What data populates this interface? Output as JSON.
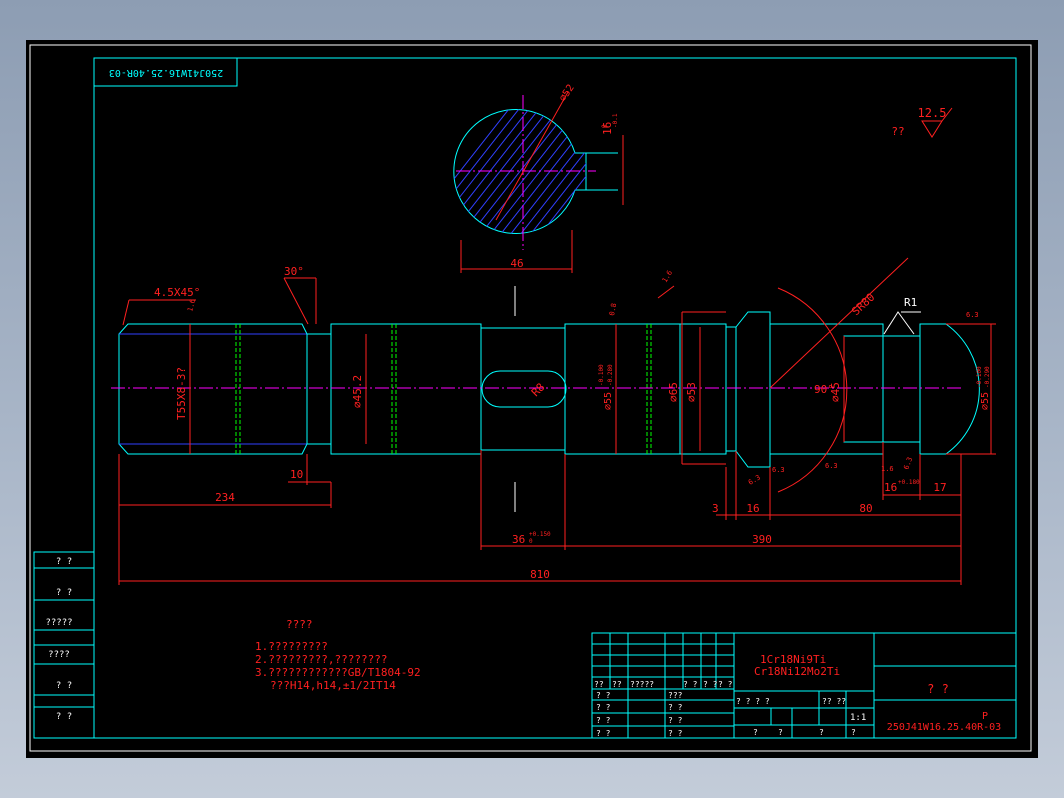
{
  "drawing": {
    "rotated_drawing_no": "250J41W16.25.40R-03",
    "roughness_symbol_value": "12.5",
    "roughness_note": "??",
    "section_dims": {
      "diameter": "⌀52",
      "keyway_depth": "16",
      "keyway_tol_top": "0",
      "keyway_tol_bot": "-0.1",
      "width": "46"
    },
    "dims": {
      "chamfer": "4.5X45°",
      "angle_30": "30°",
      "thread": "T55X8-3?",
      "dia_45_2": "⌀45.2",
      "len_10": "10",
      "len_234": "234",
      "slot_r": "R8",
      "dia_55_a": "⌀55",
      "dia_55_a_tol_top": "-0.100",
      "dia_55_a_tol_bot": "-0.280",
      "dia_65": "⌀65",
      "dia_53": "⌀53",
      "sr80": "SR80",
      "r1": "R1",
      "angle_90": "90°",
      "dia_45": "⌀45",
      "dia_55_b": "⌀55",
      "dia_55_b_tol_top": "-0.100",
      "dia_55_b_tol_bot": "-0.290",
      "len_3": "3",
      "len_16": "16",
      "len_80": "80",
      "len_16b": "16",
      "len_16b_tol": "+0.180",
      "len_17": "17",
      "len_36": "36",
      "len_36_tol_top": "+0.150",
      "len_36_tol_bot": "0",
      "len_390": "390",
      "len_810": "810",
      "rough_1_6a": "1.6",
      "rough_0_8": "0.8",
      "rough_1_6b": "1.6",
      "rough_6_3a": "6.3",
      "rough_6_3b": "6.3",
      "rough_6_3c": "6.3",
      "rough_6_3d": "6.3",
      "rough_6_3e": "6.3",
      "rough_a": "1.6",
      "rough_b": "6.3"
    },
    "notes": {
      "title": "????",
      "line1": "1.?????????",
      "line2": "2.?????????,????????",
      "line3": "3.????????????GB/T1804-92",
      "line4": "???H14,h14,±1/2IT14"
    }
  },
  "left_strip": [
    "? ?",
    "? ?",
    "?????",
    "????",
    "? ?",
    "? ?"
  ],
  "title_block": {
    "material_1": "1Cr18Ni9Ti",
    "material_2": "Cr18Ni12Mo2Ti",
    "part_name": "? ?",
    "drawing_no": "250J41W16.25.40R-03",
    "letter": "P",
    "scale": "1:1",
    "row_main": [
      "??",
      "??",
      "?????",
      "? ?",
      "? ?",
      "? ?"
    ],
    "left_rows": [
      "? ?",
      "? ?",
      "? ?",
      "? ?"
    ],
    "mid_rows": [
      "???",
      "? ?",
      "? ?",
      "? ?"
    ],
    "info_row": [
      "? ? ? ?",
      "?? ??"
    ],
    "bottom_row": [
      "?",
      "?",
      "?",
      "?"
    ]
  }
}
